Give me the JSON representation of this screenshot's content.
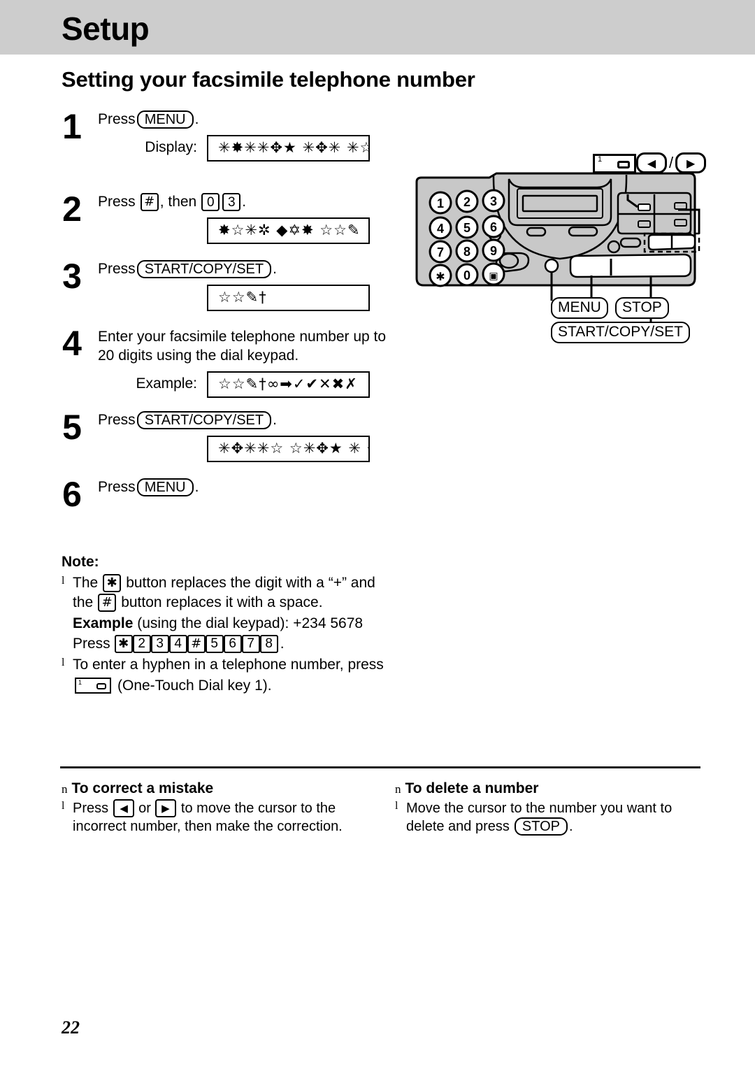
{
  "header": {
    "chapter_title": "Setup"
  },
  "section": {
    "title": "Setting your facsimile telephone number"
  },
  "steps": [
    {
      "number": "1",
      "press_label": "Press",
      "key": "MENU",
      "period": ".",
      "display_label": "Display:",
      "display_value": "✳✸✳✳✥★ ✳✥✳ ✳☆"
    },
    {
      "number": "2",
      "press_label": "Press",
      "key_hash": "#",
      "then_label": ", then",
      "key_0": "0",
      "key_3": "3",
      "period": ".",
      "display_value": "✸☆✳✲ ◆✡✸ ☆☆✎"
    },
    {
      "number": "3",
      "press_label": "Press",
      "key": "START/COPY/SET",
      "period": ".",
      "display_value": "☆☆✎†"
    },
    {
      "number": "4",
      "instruction": "Enter your facsimile telephone number up to 20 digits using the dial keypad.",
      "display_label": "Example:",
      "display_value": "☆☆✎†∞➡✓✔✕✖✗"
    },
    {
      "number": "5",
      "press_label": "Press",
      "key": "START/COPY/SET",
      "period": ".",
      "display_value": "✳✥✳✳☆ ☆✳✥★ ✳ ✳"
    },
    {
      "number": "6",
      "press_label": "Press",
      "key": "MENU",
      "period": "."
    }
  ],
  "note": {
    "title": "Note:",
    "bullet_mark": "l",
    "item1_part1": "The",
    "item1_star_key": "✱",
    "item1_part2": "button replaces the digit with a “+” and",
    "item1_part3": "the",
    "item1_hash_key": "#",
    "item1_part4": "button replaces it with a space.",
    "example_bold": "Example",
    "example_rest": "(using the dial keypad):  +234  5678",
    "press_label": "Press",
    "press_keys": [
      "✱",
      "2",
      "3",
      "4",
      "#",
      "5",
      "6",
      "7",
      "8"
    ],
    "press_period": ".",
    "item2_part1": "To enter a hyphen in a telephone number, press",
    "item2_onetouch_num": "1",
    "item2_part2": "(One-Touch Dial key 1)."
  },
  "bottom": {
    "left": {
      "square_mark": "n",
      "heading": "To correct a mistake",
      "bullet_mark": "l",
      "text_before": "Press",
      "arrow_left": "◀",
      "or_label": "or",
      "arrow_right": "▶",
      "text_after": "to move the cursor to the",
      "text_line2": "incorrect number, then make the correction."
    },
    "right": {
      "square_mark": "n",
      "heading": "To delete a number",
      "bullet_mark": "l",
      "text_line1": "Move the cursor to the number you want to",
      "text_before2": "delete and press",
      "stop_key": "STOP",
      "period": "."
    }
  },
  "figure": {
    "keypad": [
      "1",
      "2",
      "3",
      "4",
      "5",
      "6",
      "7",
      "8",
      "9",
      "✱",
      "0",
      "#"
    ],
    "onetouch_callout_num": "1",
    "arrow_left": "◀",
    "arrow_slash": "/",
    "arrow_right": "▶",
    "label_menu": "MENU",
    "label_stop": "STOP",
    "label_start": "START/COPY/SET"
  },
  "page_number": "22",
  "colors": {
    "header_band": "#cdcdcd",
    "panel_body": "#c8c8c8",
    "ink": "#000000"
  }
}
